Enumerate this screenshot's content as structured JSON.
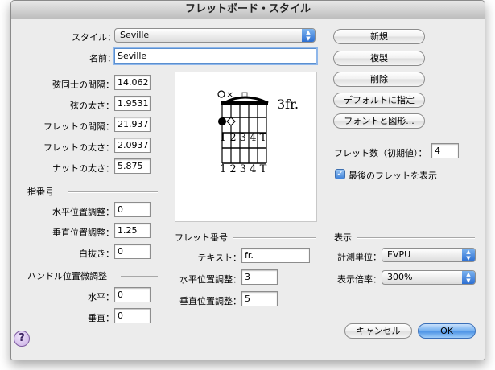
{
  "window": {
    "title": "フレットボード・スタイル"
  },
  "style": {
    "label": "スタイル：",
    "value": "Seville"
  },
  "name": {
    "label": "名前：",
    "value": "Seville"
  },
  "metrics": [
    {
      "label": "弦同士の間隔：",
      "value": "14.062"
    },
    {
      "label": "弦の太さ：",
      "value": "1.9531"
    },
    {
      "label": "フレットの間隔：",
      "value": "21.937"
    },
    {
      "label": "フレットの太さ：",
      "value": "2.0937"
    },
    {
      "label": "ナットの太さ：",
      "value": "5.875"
    }
  ],
  "fingering": {
    "heading": "指番号",
    "h_label": "水平位置調整：",
    "h_value": "0",
    "v_label": "垂直位置調整：",
    "v_value": "1.25",
    "knockout_label": "白抜き：",
    "knockout_value": "0"
  },
  "handle": {
    "heading": "ハンドル位置微調整",
    "h_label": "水平：",
    "h_value": "0",
    "v_label": "垂直：",
    "v_value": "0"
  },
  "fret_number": {
    "heading": "フレット番号",
    "text_label": "テキスト：",
    "text_value": "fr.",
    "h_label": "水平位置調整：",
    "h_value": "3",
    "v_label": "垂直位置調整：",
    "v_value": "5"
  },
  "preview": {
    "position_text": "3fr.",
    "fingers_top": "1 2 3 4 T",
    "fingers_bottom": "1 2 3 4 T"
  },
  "buttons": {
    "new": "新規",
    "duplicate": "複製",
    "delete": "削除",
    "set_default": "デフォルトに指定",
    "fonts_shapes": "フォントと図形..."
  },
  "frets": {
    "label": "フレット数（初期値）：",
    "value": "4"
  },
  "show_last": {
    "label": "最後のフレットを表示",
    "checked": true
  },
  "display": {
    "heading": "表示",
    "unit_label": "計測単位：",
    "unit_value": "EVPU",
    "zoom_label": "表示倍率：",
    "zoom_value": "300%"
  },
  "footer": {
    "cancel": "キャンセル",
    "ok": "OK",
    "help": "?"
  }
}
